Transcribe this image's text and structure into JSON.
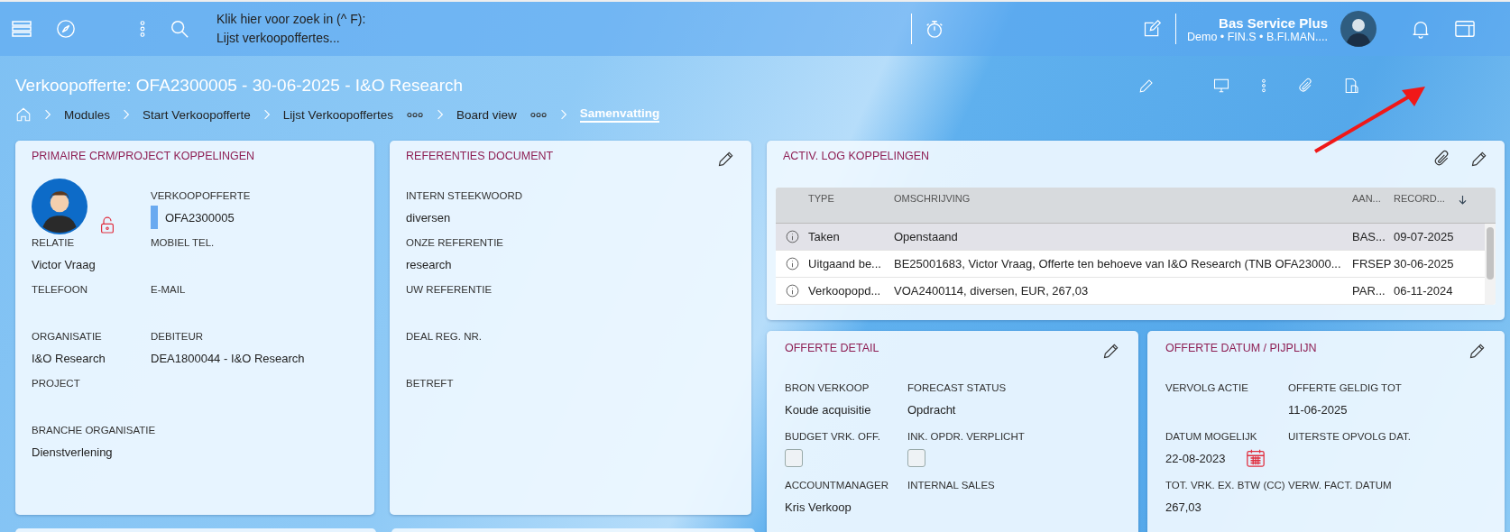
{
  "topbar": {
    "search_hint": "Klik hier voor zoek in (^ F):",
    "search_scope": "Lijst verkoopoffertes...",
    "user_name": "Bas Service Plus",
    "user_context": "Demo • FIN.S • B.FI.MAN...."
  },
  "page": {
    "title": "Verkoopofferte: OFA2300005 - 30-06-2025 - I&O Research",
    "breadcrumbs": [
      {
        "label": "Modules",
        "more": false,
        "selected": false
      },
      {
        "label": "Start Verkoopofferte",
        "more": false,
        "selected": false
      },
      {
        "label": "Lijst Verkoopoffertes",
        "more": true,
        "selected": false
      },
      {
        "label": "Board view",
        "more": true,
        "selected": false
      },
      {
        "label": "Samenvatting",
        "more": false,
        "selected": true
      }
    ]
  },
  "cards": [
    {
      "title": "PRIMAIRE CRM/PROJECT KOPPELINGEN",
      "editable": false,
      "rows": [
        [
          {
            "kind": "avatar",
            "locked": false
          },
          {
            "kind": "tagged",
            "label": "VERKOOPOFFERTE",
            "value": "OFA2300005",
            "color": "#6aaaf0"
          }
        ],
        [
          {
            "kind": "text",
            "label": "RELATIE",
            "value": "Victor Vraag"
          },
          {
            "kind": "text",
            "label": "MOBIEL TEL."
          }
        ],
        [
          {
            "kind": "text",
            "label": "TELEFOON"
          },
          {
            "kind": "text",
            "label": "E-MAIL"
          }
        ],
        [
          {
            "kind": "text",
            "label": "ORGANISATIE",
            "value": "I&O Research"
          },
          {
            "kind": "text",
            "label": "DEBITEUR",
            "value": "DEA1800044 - I&O Research"
          }
        ],
        [
          {
            "kind": "text",
            "label": "PROJECT"
          }
        ],
        [
          {
            "kind": "text",
            "label": "BRANCHE ORGANISATIE",
            "value": "Dienstverlening"
          }
        ]
      ]
    },
    {
      "title": "REFERENTIES DOCUMENT",
      "editable": true,
      "rows": [
        [
          {
            "kind": "text",
            "label": "INTERN STEEKWOORD",
            "value": "diversen"
          }
        ],
        [
          {
            "kind": "text",
            "label": "ONZE REFERENTIE",
            "value": "research"
          }
        ],
        [
          {
            "kind": "text",
            "label": "UW REFERENTIE"
          }
        ],
        [
          {
            "kind": "text",
            "label": "DEAL REG. NR."
          }
        ],
        [
          {
            "kind": "text",
            "label": "BETREFT"
          }
        ]
      ]
    }
  ],
  "activity": {
    "title": "ACTIV. LOG KOPPELINGEN",
    "columns": [
      "TYPE",
      "OMSCHRIJVING",
      "AAN...",
      "RECORD..."
    ],
    "rows": [
      {
        "selected": true,
        "cells": [
          "Taken",
          "Openstaand",
          "BAS...",
          "09-07-2025"
        ]
      },
      {
        "selected": false,
        "cells": [
          "Uitgaand be...",
          "BE25001683, Victor Vraag, Offerte ten behoeve van I&O Research (TNB OFA23000...",
          "FRSEP",
          "30-06-2025"
        ]
      },
      {
        "selected": false,
        "cells": [
          "Verkoopopd...",
          "VOA2400114, diversen, EUR, 267,03",
          "PAR...",
          "06-11-2024"
        ]
      }
    ]
  },
  "lower_cards": [
    {
      "title": "OFFERTE DETAIL",
      "editable": true,
      "rows": [
        [
          {
            "kind": "text",
            "label": "BRON VERKOOP",
            "value": "Koude acquisitie"
          },
          {
            "kind": "text",
            "label": "FORECAST STATUS",
            "value": "Opdracht"
          }
        ],
        [
          {
            "kind": "checkbox",
            "label": "BUDGET VRK. OFF.",
            "checked": false
          },
          {
            "kind": "checkbox",
            "label": "INK. OPDR. VERPLICHT",
            "checked": false
          }
        ],
        [
          {
            "kind": "text",
            "label": "ACCOUNTMANAGER",
            "value": "Kris Verkoop"
          },
          {
            "kind": "text",
            "label": "INTERNAL SALES"
          }
        ]
      ]
    },
    {
      "title": "OFFERTE DATUM / PIJPLIJN",
      "editable": true,
      "rows": [
        [
          {
            "kind": "text",
            "label": "VERVOLG ACTIE"
          },
          {
            "kind": "text",
            "label": "OFFERTE GELDIG TOT",
            "value": "11-06-2025"
          }
        ],
        [
          {
            "kind": "date",
            "label": "DATUM MOGELIJK",
            "value": "22-08-2023"
          },
          {
            "kind": "text",
            "label": "UITERSTE OPVOLG DAT."
          }
        ],
        [
          {
            "kind": "text",
            "label": "TOT. VRK. EX. BTW (CC)",
            "value": "267,03"
          },
          {
            "kind": "text",
            "label": "VERW. FACT. DATUM"
          }
        ]
      ]
    }
  ]
}
